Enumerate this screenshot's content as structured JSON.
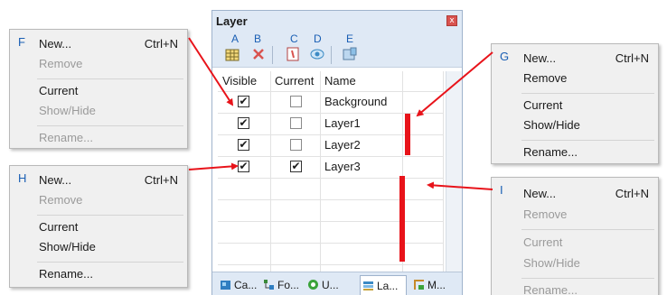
{
  "menus": {
    "F": {
      "tag": "F",
      "new": "New...",
      "new_shortcut": "Ctrl+N",
      "remove": "Remove",
      "current": "Current",
      "showhide": "Show/Hide",
      "rename": "Rename..."
    },
    "G": {
      "tag": "G",
      "new": "New...",
      "new_shortcut": "Ctrl+N",
      "remove": "Remove",
      "current": "Current",
      "showhide": "Show/Hide",
      "rename": "Rename..."
    },
    "H": {
      "tag": "H",
      "new": "New...",
      "new_shortcut": "Ctrl+N",
      "remove": "Remove",
      "current": "Current",
      "showhide": "Show/Hide",
      "rename": "Rename..."
    },
    "I": {
      "tag": "I",
      "new": "New...",
      "new_shortcut": "Ctrl+N",
      "remove": "Remove",
      "current": "Current",
      "showhide": "Show/Hide",
      "rename": "Rename..."
    }
  },
  "panel": {
    "title": "Layer",
    "close": "x",
    "toolbar_letters": [
      "A",
      "B",
      "C",
      "D",
      "E"
    ],
    "columns": {
      "visible": "Visible",
      "current": "Current",
      "name": "Name"
    },
    "layers": [
      {
        "name": "Background",
        "visible": true,
        "current": false
      },
      {
        "name": "Layer1",
        "visible": true,
        "current": false
      },
      {
        "name": "Layer2",
        "visible": true,
        "current": false
      },
      {
        "name": "Layer3",
        "visible": true,
        "current": true
      }
    ],
    "tabs": [
      "Ca...",
      "Fo...",
      "U...",
      "La...",
      "M..."
    ],
    "active_tab": "La..."
  },
  "colors": {
    "annotation": "#e8131a",
    "letter": "#1a5fb4",
    "panel_bg": "#dfe9f5"
  }
}
